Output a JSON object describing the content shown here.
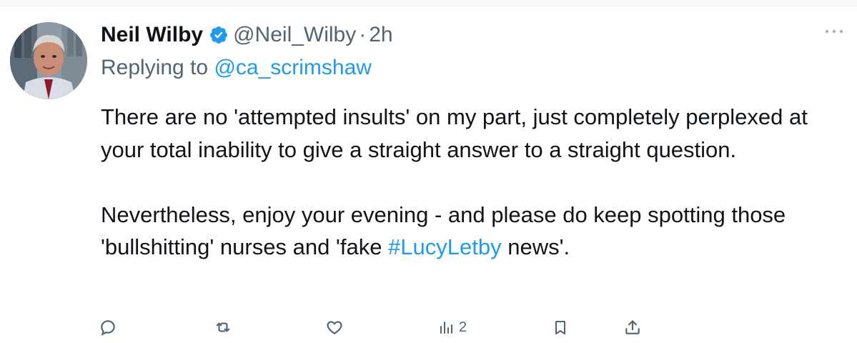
{
  "tweet": {
    "author_name": "Neil Wilby",
    "handle": "@Neil_Wilby",
    "separator": "·",
    "time": "2h",
    "replying_prefix": "Replying to",
    "replying_to": "@ca_scrimshaw",
    "paragraph1": "There are no 'attempted insults' on my part, just completely perplexed at your total inability to give a straight answer to a straight question.",
    "paragraph2_before": "Nevertheless, enjoy your evening - and please do keep spotting those 'bullshitting' nurses and 'fake ",
    "hashtag": "#LucyLetby",
    "paragraph2_after": " news'."
  },
  "actions": {
    "reply_icon": "reply-icon",
    "retweet_icon": "retweet-icon",
    "like_icon": "heart-icon",
    "views_icon": "bar-chart-icon",
    "views_count": "2",
    "bookmark_icon": "bookmark-icon",
    "share_icon": "share-icon"
  },
  "colors": {
    "accent": "#1d9bf0",
    "secondary_text": "#536471",
    "primary_text": "#0f1419"
  }
}
